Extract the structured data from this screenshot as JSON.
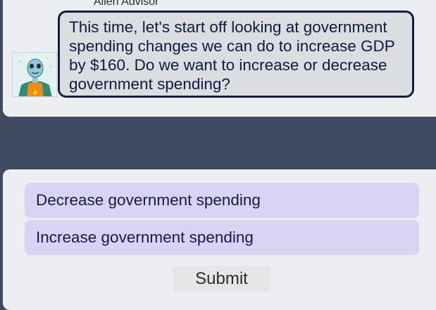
{
  "chat": {
    "advisor_name": "Alien Advisor",
    "message": "This time, let's start off looking at government spending changes we can do to increase GDP by $160.  Do we want to increase or decrease government spending?"
  },
  "answers": {
    "options": [
      {
        "label": "Decrease government spending"
      },
      {
        "label": "Increase government spending"
      }
    ],
    "submit_label": "Submit"
  },
  "colors": {
    "background": "#3f4a60",
    "panel": "#eceef1",
    "bubble": "#dcdde1",
    "bubble_border": "#0f1f45",
    "option": "#d9d4f3"
  }
}
